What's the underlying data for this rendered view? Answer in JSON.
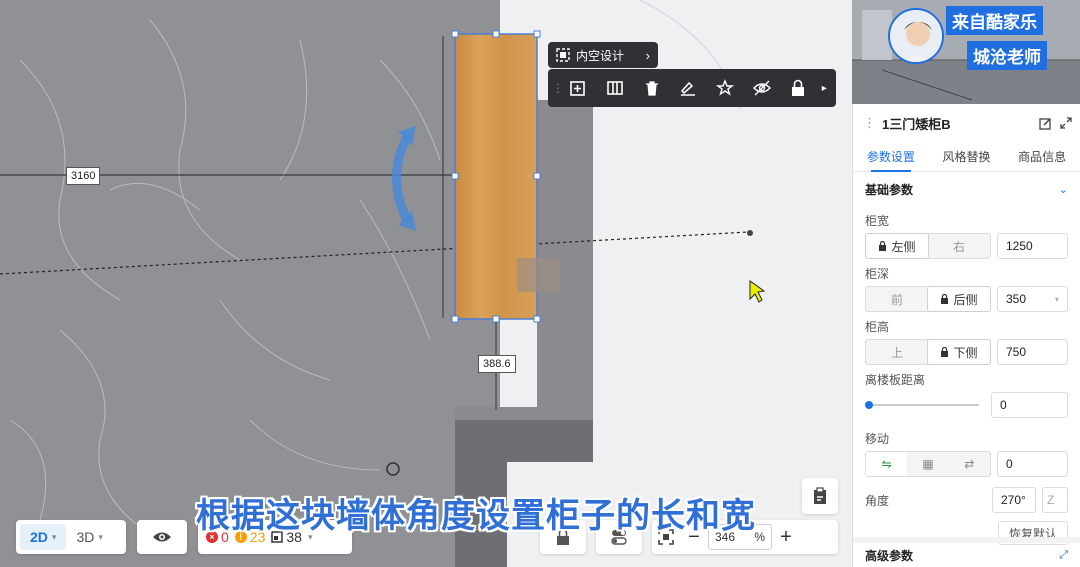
{
  "canvas": {
    "dim_horizontal": "3160",
    "dim_vertical": "388.6",
    "name_bar_label": "内空设计",
    "toolbar_icons": [
      "add-cabinet-icon",
      "split-icon",
      "delete-icon",
      "brush-icon",
      "star-icon",
      "hide-icon",
      "lock-icon"
    ]
  },
  "view_switch": {
    "opt_2d": "2D",
    "opt_3d": "3D"
  },
  "status": {
    "errors": "0",
    "warnings": "23",
    "items": "38",
    "error_color": "#e03131",
    "warning_color": "#f59f00"
  },
  "zoom": {
    "value": "346",
    "unit": "%"
  },
  "caption": "根据这块墙体角度设置柜子的长和宽",
  "watermark": {
    "line1": "来自酷家乐",
    "line2": "城沧老师"
  },
  "panel": {
    "title": "1三门矮柜B",
    "tabs": [
      "参数设置",
      "风格替换",
      "商品信息"
    ],
    "section_basic": "基础参数",
    "width": {
      "label": "柜宽",
      "left": "左侧",
      "right": "右",
      "value": "1250"
    },
    "depth": {
      "label": "柜深",
      "front": "前",
      "back": "后侧",
      "value": "350"
    },
    "height": {
      "label": "柜高",
      "top": "上",
      "bottom": "下侧",
      "value": "750"
    },
    "floor_dist": {
      "label": "离楼板距离",
      "value": "0"
    },
    "move": {
      "label": "移动",
      "value": "0"
    },
    "angle": {
      "label": "角度",
      "value": "270°",
      "axis": "Z"
    },
    "restore_label": "恢复默认",
    "section_advanced": "高级参数"
  },
  "accent_color": "#1a73e8"
}
